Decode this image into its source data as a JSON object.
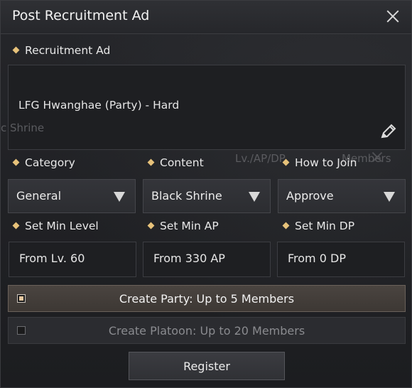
{
  "window": {
    "title": "Post Recruitment Ad"
  },
  "ad_section": {
    "label": "Recruitment Ad",
    "text": "LFG Hwanghae (Party) - Hard",
    "ghost_left": "c Shrine",
    "ghost_row": "Lv./AP/DP",
    "ghost_row_right": "Members"
  },
  "category": {
    "label": "Category",
    "value": "General"
  },
  "content": {
    "label": "Content",
    "value": "Black Shrine"
  },
  "how_to_join": {
    "label": "How to Join",
    "value": "Approve"
  },
  "min_level": {
    "label": "Set Min Level",
    "value": "From Lv. 60"
  },
  "min_ap": {
    "label": "Set Min AP",
    "value": "From 330 AP"
  },
  "min_dp": {
    "label": "Set Min DP",
    "value": "From 0 DP"
  },
  "options": [
    {
      "label": "Create Party: Up to 5 Members",
      "checked": true
    },
    {
      "label": "Create Platoon: Up to 20 Members",
      "checked": false
    }
  ],
  "register_label": "Register",
  "colors": {
    "accent": "#e7c27a",
    "background": "#1e1f22"
  },
  "icons": {
    "close": "close-icon",
    "edit": "pencil-icon",
    "dropdown": "triangle-down-icon"
  }
}
